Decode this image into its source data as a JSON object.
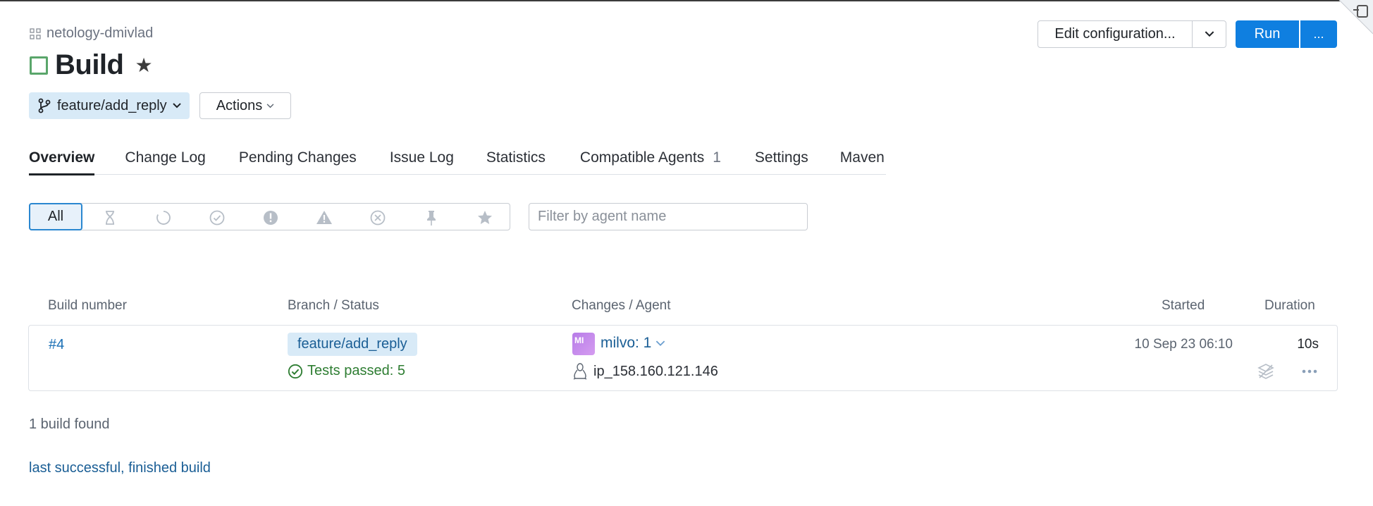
{
  "header": {
    "project": "netology-dmivlad",
    "title": "Build",
    "branch": "feature/add_reply",
    "actions_label": "Actions",
    "edit_config_label": "Edit configuration...",
    "run_label": "Run",
    "more_label": "..."
  },
  "tabs": [
    {
      "label": "Overview",
      "active": true
    },
    {
      "label": "Change Log"
    },
    {
      "label": "Pending Changes"
    },
    {
      "label": "Issue Log"
    },
    {
      "label": "Statistics"
    },
    {
      "label": "Compatible Agents",
      "count": "1"
    },
    {
      "label": "Settings"
    },
    {
      "label": "Maven"
    }
  ],
  "filters": {
    "all_label": "All",
    "icons": [
      "hourglass-icon",
      "running-icon",
      "success-icon",
      "error-icon",
      "warning-icon",
      "cancelled-icon",
      "pin-icon",
      "star-icon"
    ],
    "agent_placeholder": "Filter by agent name"
  },
  "table": {
    "columns": {
      "build_number": "Build number",
      "branch_status": "Branch / Status",
      "changes_agent": "Changes / Agent",
      "started": "Started",
      "duration": "Duration"
    },
    "rows": [
      {
        "number": "#4",
        "branch": "feature/add_reply",
        "status": "Tests passed: 5",
        "avatar_initials": "MI",
        "changes": "milvo: 1",
        "agent": "ip_158.160.121.146",
        "started": "10 Sep 23 06:10",
        "duration": "10s"
      }
    ]
  },
  "footer": {
    "found": "1 build found",
    "last_link": "last successful, finished build"
  },
  "colors": {
    "accent": "#0f7fe0",
    "success": "#2e7d32",
    "branch_bg": "#d8eaf7",
    "link": "#1a5e95"
  }
}
